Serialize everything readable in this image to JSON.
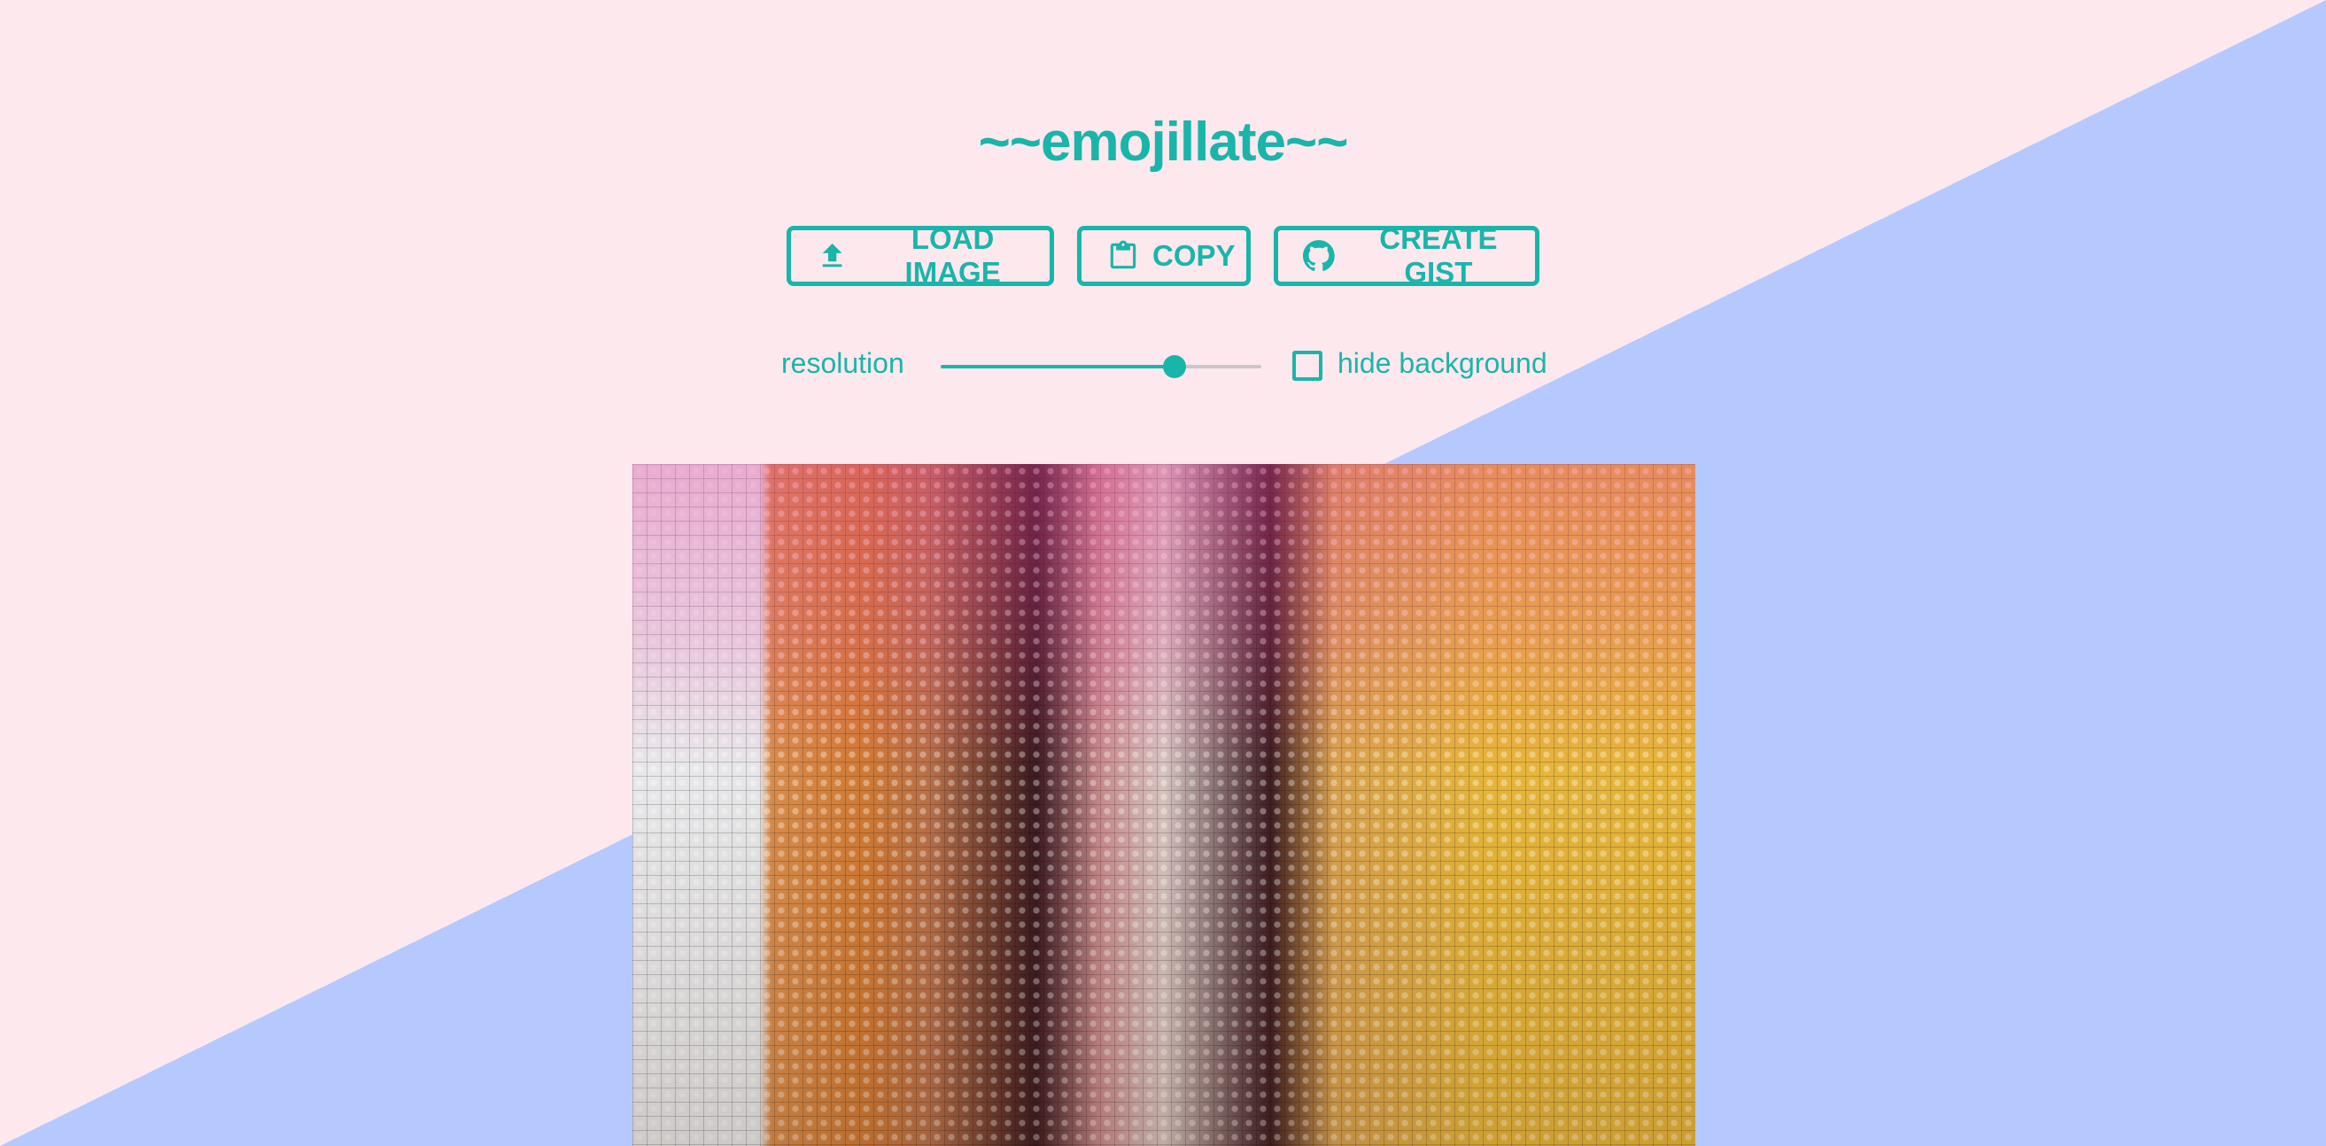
{
  "app": {
    "title": "~~emojillate~~"
  },
  "toolbar": {
    "load_label": "LOAD IMAGE",
    "load_icon": "upload-icon",
    "copy_label": "COPY",
    "copy_icon": "clipboard-icon",
    "gist_label": "CREATE GIST",
    "gist_icon": "github-icon"
  },
  "controls": {
    "resolution_label": "resolution",
    "resolution_value": 0.73,
    "hide_background_label": "hide background",
    "hide_background_checked": false
  },
  "colors": {
    "accent": "#1ab5aa",
    "background_pink": "#fde8ee",
    "background_blue": "#b6c9fe"
  }
}
